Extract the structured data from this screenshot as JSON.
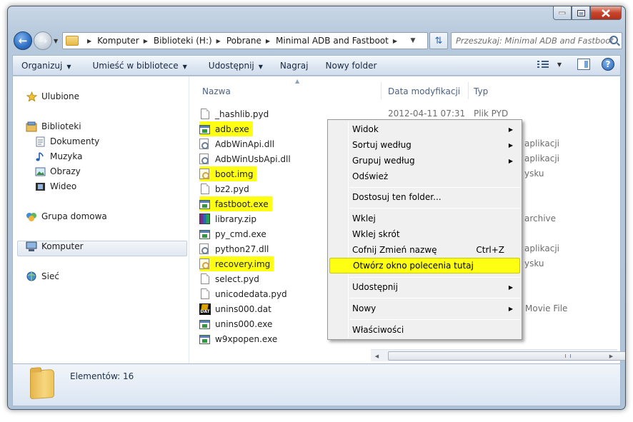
{
  "address": {
    "crumbs": [
      "Komputer",
      "Biblioteki (H:)",
      "Pobrane",
      "Minimal ADB and Fastboot"
    ],
    "search_placeholder": "Przeszukaj: Minimal ADB and Fastboot"
  },
  "toolbar": {
    "organize": "Organizuj",
    "include_library": "Umieść w bibliotece",
    "share": "Udostępnij",
    "burn": "Nagraj",
    "new_folder": "Nowy folder"
  },
  "nav": {
    "favorites": "Ulubione",
    "libraries": "Biblioteki",
    "documents": "Dokumenty",
    "music": "Muzyka",
    "pictures": "Obrazy",
    "videos": "Wideo",
    "homegroup": "Grupa domowa",
    "computer": "Komputer",
    "network": "Sieć"
  },
  "columns": {
    "name": "Nazwa",
    "date": "Data modyfikacji",
    "type": "Typ"
  },
  "files": [
    {
      "name": "_hashlib.pyd",
      "icon": "doc",
      "date": "2012-04-11 07:31",
      "type": "Plik PYD",
      "highlight": false
    },
    {
      "name": "adb.exe",
      "icon": "exe",
      "date": "",
      "type": "",
      "highlight": true
    },
    {
      "name": "AdbWinApi.dll",
      "icon": "dll",
      "date": "",
      "type": "aplikacji",
      "highlight": false
    },
    {
      "name": "AdbWinUsbApi.dll",
      "icon": "dll",
      "date": "",
      "type": "aplikacji",
      "highlight": false
    },
    {
      "name": "boot.img",
      "icon": "img",
      "date": "",
      "type": "ysku",
      "highlight": true
    },
    {
      "name": "bz2.pyd",
      "icon": "doc",
      "date": "",
      "type": "",
      "highlight": false
    },
    {
      "name": "fastboot.exe",
      "icon": "exe",
      "date": "",
      "type": "",
      "highlight": true
    },
    {
      "name": "library.zip",
      "icon": "zip",
      "date": "",
      "type": "archive",
      "highlight": false
    },
    {
      "name": "py_cmd.exe",
      "icon": "exe",
      "date": "",
      "type": "",
      "highlight": false
    },
    {
      "name": "python27.dll",
      "icon": "dll",
      "date": "",
      "type": "aplikacji",
      "highlight": false
    },
    {
      "name": "recovery.img",
      "icon": "img",
      "date": "",
      "type": "ysku",
      "highlight": true
    },
    {
      "name": "select.pyd",
      "icon": "doc",
      "date": "",
      "type": "",
      "highlight": false
    },
    {
      "name": "unicodedata.pyd",
      "icon": "doc",
      "date": "",
      "type": "",
      "highlight": false
    },
    {
      "name": "unins000.dat",
      "icon": "dat",
      "date": "",
      "type": "Movie File",
      "highlight": false
    },
    {
      "name": "unins000.exe",
      "icon": "exe",
      "date": "",
      "type": "",
      "highlight": false
    },
    {
      "name": "w9xpopen.exe",
      "icon": "exe",
      "date": "",
      "type": "",
      "highlight": false
    }
  ],
  "status": {
    "items": "Elementów: 16"
  },
  "context_menu": {
    "view": "Widok",
    "sort_by": "Sortuj według",
    "group_by": "Grupuj według",
    "refresh": "Odśwież",
    "customize": "Dostosuj ten folder...",
    "paste": "Wklej",
    "paste_shortcut": "Wklej skrót",
    "undo_rename": "Cofnij Zmień nazwę",
    "undo_shortcut": "Ctrl+Z",
    "open_cmd": "Otwórz okno polecenia tutaj",
    "share_with": "Udostępnij",
    "new": "Nowy",
    "properties": "Właściwości"
  },
  "colors": {
    "highlight": "#ffff14",
    "accent": "#2f6fc2"
  }
}
